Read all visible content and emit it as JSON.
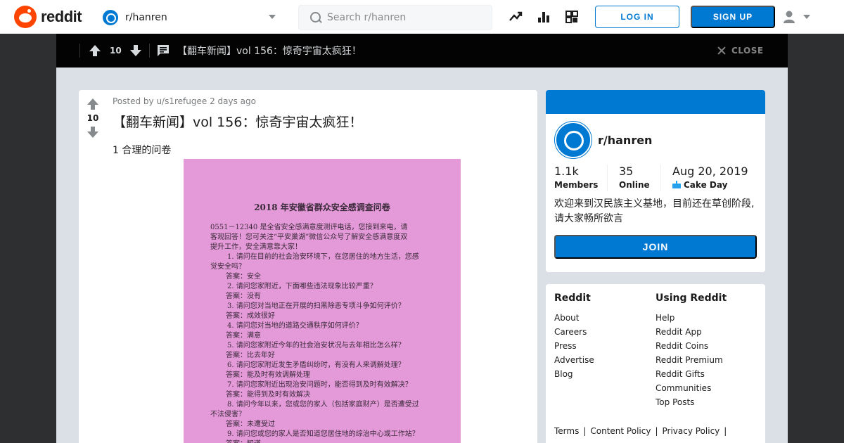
{
  "header": {
    "logo_text": "reddit",
    "subreddit": "r/hanren",
    "search_placeholder": "Search r/hanren",
    "login_label": "LOG IN",
    "signup_label": "SIGN UP"
  },
  "topbar": {
    "score": "10",
    "title": "【翻车新闻】vol 156：惊奇宇宙太疯狂！",
    "close_label": "CLOSE"
  },
  "post": {
    "score": "10",
    "meta": "Posted by u/s1refugee 2 days ago",
    "title": "【翻车新闻】vol 156：惊奇宇宙太疯狂！",
    "flair": "1 合理的问卷",
    "image": {
      "doc_title": "2018 年安徽省群众安全感调查问卷",
      "lines": [
        "0551－12340 是全省安全感满意度测评电话，您接到来电，请",
        "客观回答！您可关注“平安巢湖”微信公众号了解安全感满意度双",
        "提升工作，安全满意靠大家！",
        "1. 请问在目前的社会治安环境下，在您居住的地方生活，您感",
        "觉安全吗？",
        "答案：安全",
        "2. 请问您家附近，下面哪些违法现象比较严重？",
        "答案：没有",
        "3. 请问您对当地正在开展的扫黑除恶专项斗争如何评价？",
        "答案：成效很好",
        "4. 请问您对当地的道路交通秩序如何评价？",
        "答案：满意",
        "5. 请问您家附近今年的社会治安状况与去年相比怎么样？",
        "答案：比去年好",
        "6. 请问您家附近发生矛盾纠纷时，有没有人来调解处理？",
        "答案：能及时有效调解处理",
        "7. 请问您家附近出现治安问题时，能否得到及时有效解决？",
        "答案：能得到及时有效解决",
        "8. 请问今年以来，您或您的家人（包括家庭财产）是否遭受过",
        "不法侵害？",
        "答案：未遭受过",
        "9. 请问您或您的家人是否知道您居住地的综治中心或工作站？",
        "答案：知道"
      ]
    }
  },
  "sidebar": {
    "name": "r/hanren",
    "members_value": "1.1k",
    "members_label": "Members",
    "online_value": "35",
    "online_label": "Online",
    "cake_value": "Aug 20, 2019",
    "cake_label": "Cake Day",
    "description": "欢迎来到汉民族主义基地，目前还在草创阶段,请大家畅所欲言",
    "join_label": "JOIN"
  },
  "links": {
    "reddit_heading": "Reddit",
    "reddit_items": [
      "About",
      "Careers",
      "Press",
      "Advertise",
      "Blog"
    ],
    "using_heading": "Using Reddit",
    "using_items": [
      "Help",
      "Reddit App",
      "Reddit Coins",
      "Reddit Premium",
      "Reddit Gifts",
      "Communities",
      "Top Posts"
    ],
    "legal": [
      "Terms",
      "Content Policy",
      "Privacy Policy"
    ]
  },
  "colors": {
    "brand": "#ff4500",
    "accent": "#0079d3",
    "overlay_bg": "#dae0e6",
    "topbar_bg": "#030303",
    "image_bg": "#e49ad8"
  }
}
